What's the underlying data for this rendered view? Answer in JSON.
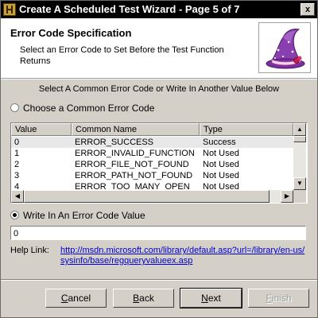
{
  "window": {
    "title": "Create A Scheduled Test Wizard - Page 5 of 7",
    "close_label": "x"
  },
  "header": {
    "title": "Error Code Specification",
    "description": "Select an Error Code to Set Before the Test Function Returns"
  },
  "instruction": "Select A Common Error Code or Write In Another Value Below",
  "radio_common": {
    "label": "Choose a Common Error Code",
    "checked": false
  },
  "list": {
    "columns": [
      "Value",
      "Common Name",
      "Type"
    ],
    "rows": [
      {
        "value": "0",
        "name": "ERROR_SUCCESS",
        "type": "Success"
      },
      {
        "value": "1",
        "name": "ERROR_INVALID_FUNCTION",
        "type": "Not Used"
      },
      {
        "value": "2",
        "name": "ERROR_FILE_NOT_FOUND",
        "type": "Not Used"
      },
      {
        "value": "3",
        "name": "ERROR_PATH_NOT_FOUND",
        "type": "Not Used"
      },
      {
        "value": "4",
        "name": "ERROR_TOO_MANY_OPEN",
        "type": "Not Used"
      }
    ]
  },
  "radio_custom": {
    "label": "Write In An Error Code Value",
    "checked": true
  },
  "error_code_value": "0",
  "help": {
    "label": "Help Link:",
    "url": "http://msdn.microsoft.com/library/default.asp?url=/library/en-us/sysinfo/base/regqueryvalueex.asp"
  },
  "buttons": {
    "cancel": {
      "mnemonic": "C",
      "rest": "ancel"
    },
    "back": {
      "mnemonic": "B",
      "rest": "ack"
    },
    "next": {
      "mnemonic": "N",
      "rest": "ext"
    },
    "finish": {
      "mnemonic": "F",
      "rest": "inish"
    }
  },
  "colors": {
    "titlebar": "#000000",
    "dialog": "#d4d0c8",
    "link": "#0000cc",
    "hat_purple": "#8a3fb0"
  }
}
